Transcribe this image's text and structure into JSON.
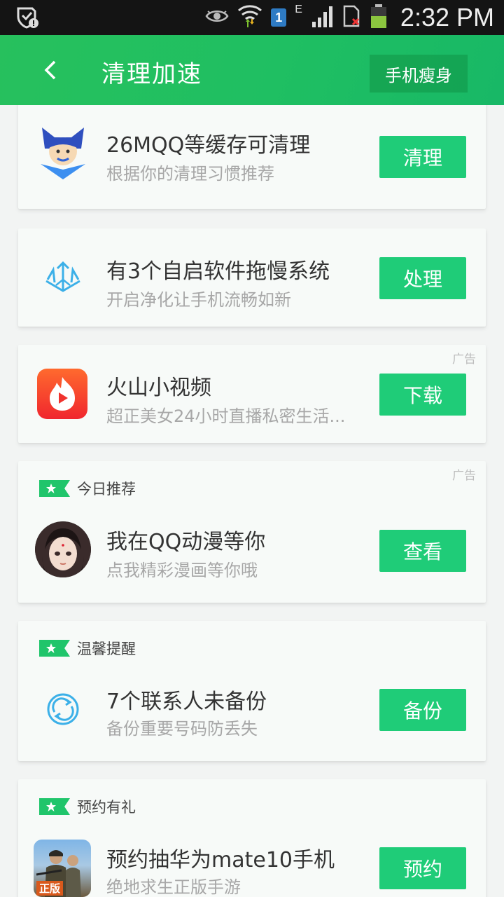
{
  "status_bar": {
    "time": "2:32 PM",
    "sim_badge": "1",
    "network_type": "E",
    "icons": [
      "shield-notification-icon",
      "eye-icon",
      "wifi-icon",
      "sim-badge-icon",
      "signal-icon",
      "sim-card-icon",
      "battery-icon"
    ]
  },
  "app_bar": {
    "title": "清理加速",
    "action_label": "手机瘦身",
    "back_icon": "chevron-left-icon"
  },
  "colors": {
    "app_bar_green": "#22be60",
    "button_green": "#1fcc78",
    "card_background": "#f7faf8"
  },
  "cards": [
    {
      "title": "26MQQ等缓存可清理",
      "subtitle": "根据你的清理习惯推荐",
      "button": "清理",
      "icon": "cleaner-mascot-icon"
    },
    {
      "title": "有3个自启软件拖慢系统",
      "subtitle": "开启净化让手机流畅如新",
      "button": "处理",
      "icon": "trident-icon"
    },
    {
      "ad": "广告",
      "title": "火山小视频",
      "subtitle": "超正美女24小时直播私密生活...",
      "button": "下载",
      "icon": "huoshan-video-logo-icon"
    },
    {
      "ad": "广告",
      "tag": "今日推荐",
      "title": "我在QQ动漫等你",
      "subtitle": "点我精彩漫画等你哦",
      "button": "查看",
      "icon": "comic-avatar-icon"
    },
    {
      "tag": "温馨提醒",
      "title": "7个联系人未备份",
      "subtitle": "备份重要号码防丢失",
      "button": "备份",
      "icon": "sync-icon"
    },
    {
      "tag": "预约有礼",
      "title": "预约抽华为mate10手机",
      "subtitle": "绝地求生正版手游",
      "button": "预约",
      "icon": "game-app-icon",
      "icon_label": "正版"
    }
  ]
}
